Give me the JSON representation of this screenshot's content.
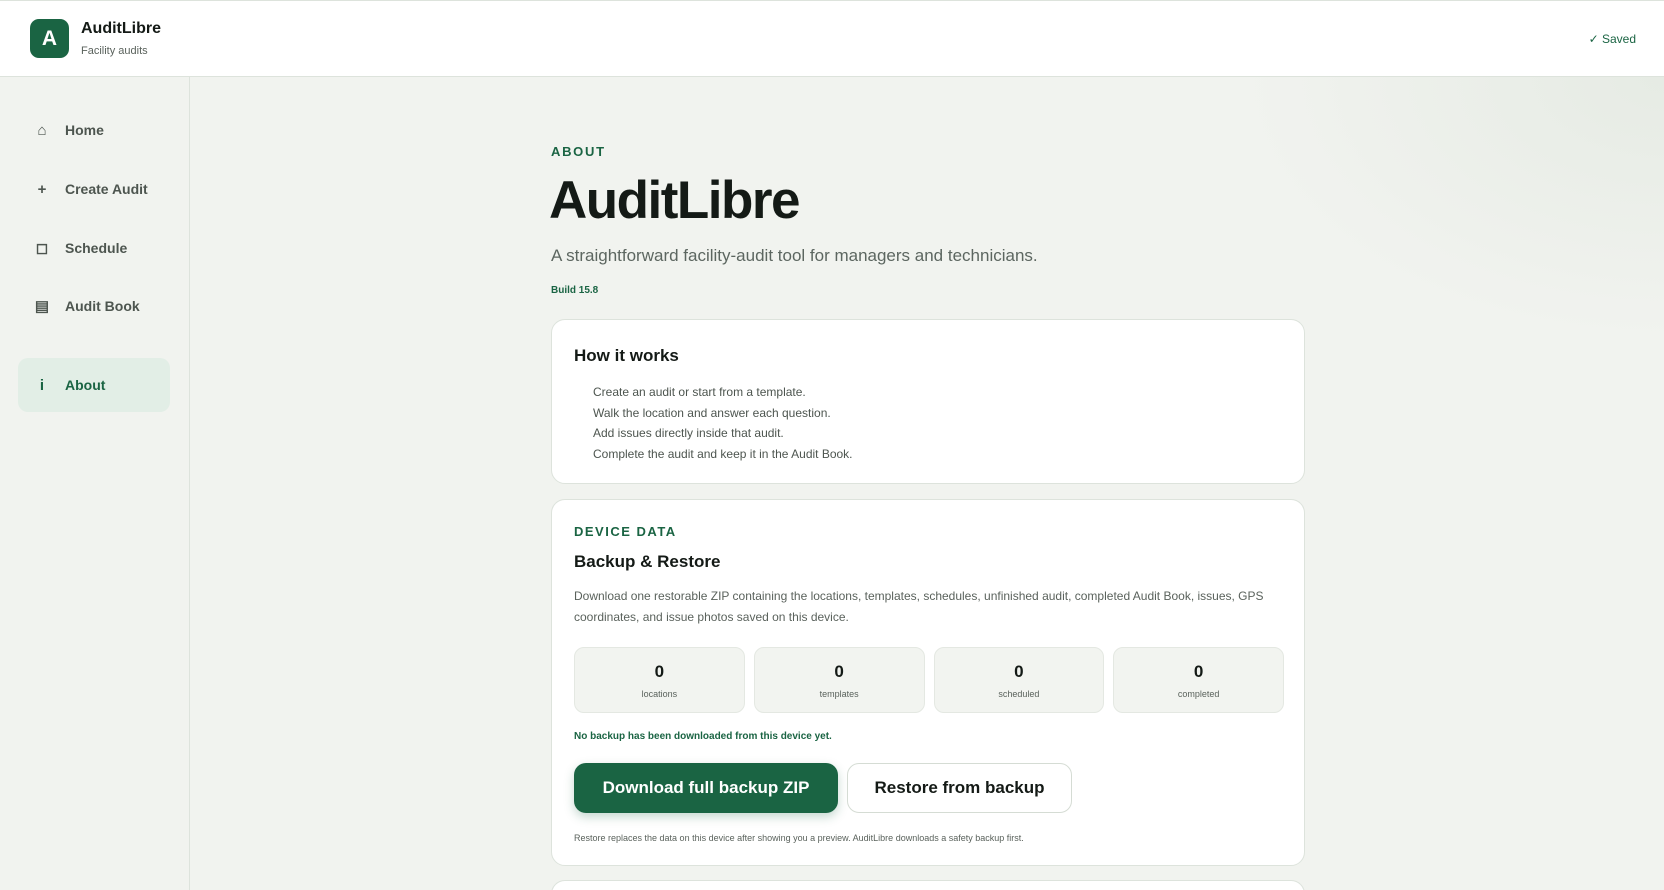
{
  "header": {
    "logo_letter": "A",
    "app_title": "AuditLibre",
    "app_subtitle": "Facility audits",
    "save_status": "✓ Saved"
  },
  "sidebar": {
    "items": [
      {
        "icon": "home-icon",
        "glyph": "⌂",
        "label": "Home",
        "active": false
      },
      {
        "icon": "plus-icon",
        "glyph": "+",
        "label": "Create Audit",
        "active": false
      },
      {
        "icon": "calendar-icon",
        "glyph": "◻",
        "label": "Schedule",
        "active": false
      },
      {
        "icon": "book-icon",
        "glyph": "▤",
        "label": "Audit Book",
        "active": false
      },
      {
        "icon": "info-icon",
        "glyph": "i",
        "label": "About",
        "active": true
      }
    ]
  },
  "about": {
    "eyebrow": "ABOUT",
    "title": "AuditLibre",
    "tagline": "A straightforward facility-audit tool for managers and technicians.",
    "build": "Build 15.8"
  },
  "how_it_works": {
    "title": "How it works",
    "steps": [
      "Create an audit or start from a template.",
      "Walk the location and answer each question.",
      "Add issues directly inside that audit.",
      "Complete the audit and keep it in the Audit Book."
    ]
  },
  "device_data": {
    "eyebrow": "DEVICE DATA",
    "title": "Backup & Restore",
    "description": "Download one restorable ZIP containing the locations, templates, schedules, unfinished audit, completed Audit Book, issues, GPS coordinates, and issue photos saved on this device.",
    "stats": [
      {
        "value": "0",
        "label": "locations"
      },
      {
        "value": "0",
        "label": "templates"
      },
      {
        "value": "0",
        "label": "scheduled"
      },
      {
        "value": "0",
        "label": "completed"
      }
    ],
    "notice": "No backup has been downloaded from this device yet.",
    "download_label": "Download full backup ZIP",
    "restore_label": "Restore from backup",
    "fineprint": "Restore replaces the data on this device after showing you a preview. AuditLibre downloads a safety backup first."
  },
  "colors": {
    "accent": "#1a6443",
    "background": "#f1f3ef",
    "active_nav_bg": "#e2eee6"
  }
}
